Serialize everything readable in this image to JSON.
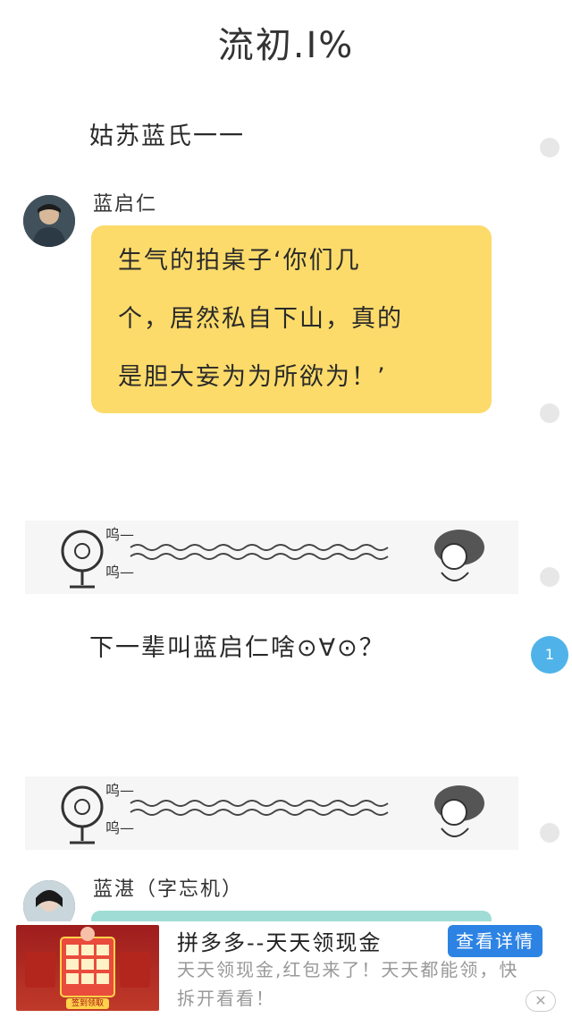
{
  "header": {
    "title": "流初.I%"
  },
  "story": {
    "narration_1": "姑苏蓝氏一一",
    "speaker_1": "蓝启仁",
    "bubble_1": [
      "生气的拍桌子‘你们几",
      "个，居然私自下山，真的",
      "是胆大妄为为所欲为！’"
    ],
    "strip_top_label": "呜—",
    "strip_bottom_label": "呜—",
    "narration_2": "下一辈叫蓝启仁啥⊙∀⊙？",
    "speaker_2": "蓝湛（字忘机）"
  },
  "side_dots": {
    "active_label": "1"
  },
  "ad": {
    "title": "拼多多--天天领现金",
    "description": "天天领现金,红包来了！天天都能领，快拆开看看！",
    "button_label": "查看详情",
    "close_symbol": "✕",
    "thumb_label": "签到领取"
  },
  "colors": {
    "bubble_yellow": "#fcdb6a",
    "bubble_teal": "#9fdcd6",
    "accent_blue": "#4fb3e9",
    "ad_button": "#2d83e3"
  }
}
